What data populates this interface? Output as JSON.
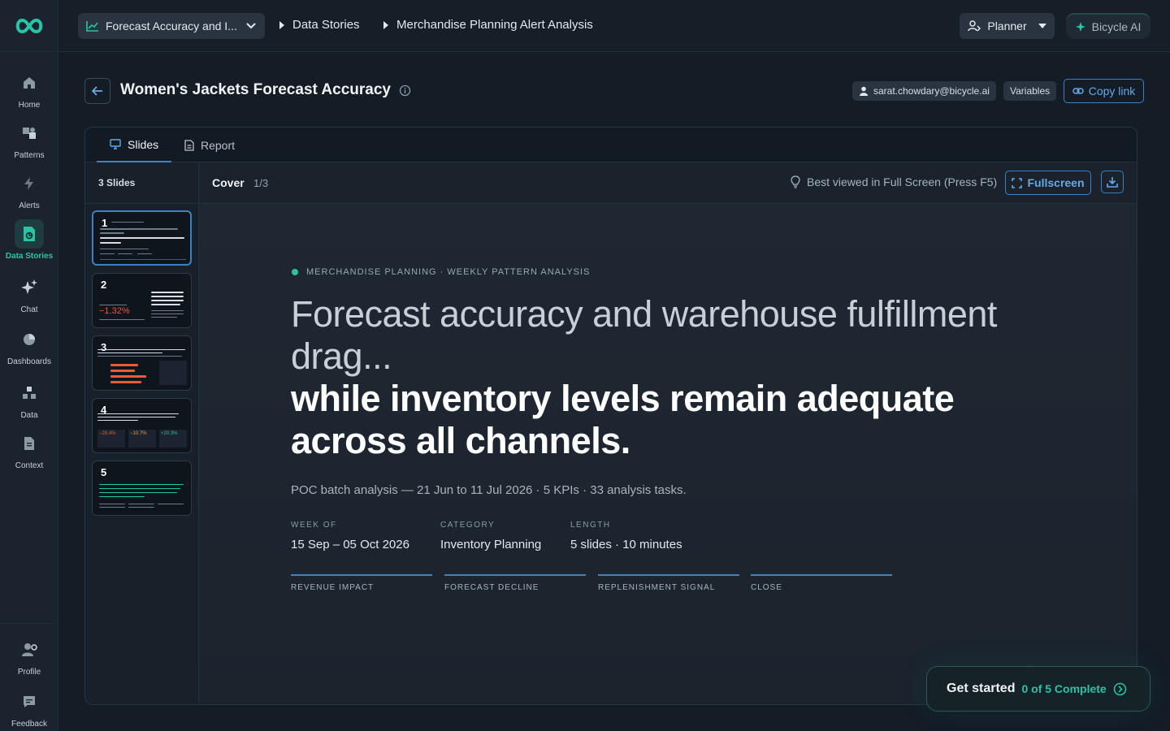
{
  "nav": {
    "items": [
      {
        "key": "home",
        "label": "Home",
        "icon": "home-icon"
      },
      {
        "key": "patterns",
        "label": "Patterns",
        "icon": "patterns-icon"
      },
      {
        "key": "alerts",
        "label": "Alerts",
        "icon": "bolt-icon"
      },
      {
        "key": "data_stories",
        "label": "Data Stories",
        "icon": "data-stories-icon",
        "active": true
      },
      {
        "key": "chat",
        "label": "Chat",
        "icon": "sparkle-icon"
      },
      {
        "key": "dashboards",
        "label": "Dashboards",
        "icon": "pie-chart-icon"
      },
      {
        "key": "data",
        "label": "Data",
        "icon": "cubes-icon"
      },
      {
        "key": "context",
        "label": "Context",
        "icon": "document-icon"
      }
    ],
    "bottom": [
      {
        "key": "profile",
        "label": "Profile",
        "icon": "profile-gear-icon"
      },
      {
        "key": "feedback",
        "label": "Feedback",
        "icon": "feedback-icon"
      }
    ]
  },
  "header": {
    "workspace": "Forecast Accuracy and I...",
    "breadcrumbs": [
      "Data Stories",
      "Merchandise Planning Alert Analysis"
    ],
    "role": "Planner",
    "ai_button": "Bicycle AI"
  },
  "page": {
    "title": "Women's Jackets Forecast Accuracy",
    "user_email": "sarat.chowdary@bicycle.ai",
    "variables_label": "Variables",
    "copy_link_label": "Copy link"
  },
  "tabs": [
    {
      "label": "Slides",
      "active": true
    },
    {
      "label": "Report",
      "active": false
    }
  ],
  "slides_panel": {
    "count_label": "3 Slides",
    "thumbs": [
      {
        "num": "1"
      },
      {
        "num": "2",
        "figure": "−1.32%"
      },
      {
        "num": "3"
      },
      {
        "num": "4",
        "figures": [
          "−28.4%",
          "−10.7%",
          "+20.3%"
        ]
      },
      {
        "num": "5"
      }
    ]
  },
  "viewer": {
    "slide_title": "Cover",
    "slide_position": "1/3",
    "hint": "Best viewed in Full Screen (Press F5)",
    "fullscreen_label": "Fullscreen"
  },
  "slide": {
    "eyebrow": "MERCHANDISE PLANNING · WEEKLY PATTERN ANALYSIS",
    "headline_light": "Forecast accuracy and warehouse fulfillment drag...",
    "headline_bold": "while inventory levels remain adequate across all channels.",
    "subtitle": "POC batch analysis — 21 Jun to 11 Jul 2026 · 5 KPIs · 33 analysis tasks.",
    "meta": [
      {
        "label": "WEEK OF",
        "value": "15 Sep – 05 Oct 2026"
      },
      {
        "label": "CATEGORY",
        "value": "Inventory Planning"
      },
      {
        "label": "LENGTH",
        "value": "5 slides · 10 minutes"
      }
    ],
    "sections": [
      "REVENUE IMPACT",
      "FORECAST DECLINE",
      "REPLENISHMENT SIGNAL",
      "CLOSE"
    ]
  },
  "onboarding": {
    "label": "Get started",
    "progress": "0 of 5 Complete"
  },
  "colors": {
    "accent_teal": "#2bc3a6",
    "accent_blue": "#3b82c4",
    "negative_red": "#e85a3c"
  }
}
